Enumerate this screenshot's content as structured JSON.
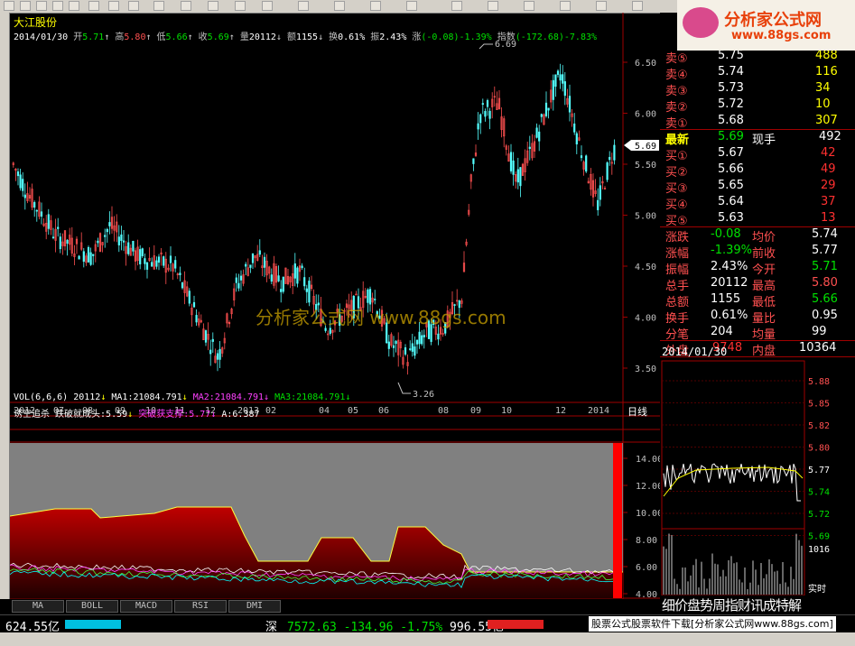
{
  "stock": {
    "name": "大江股份",
    "date": "2014/01/30",
    "open_label": "开",
    "open": "5.71",
    "high_label": "高",
    "high": "5.80",
    "low_label": "低",
    "low": "5.66",
    "close_label": "收",
    "close": "5.69",
    "volume_label": "量",
    "volume": "20112",
    "amount_label": "额",
    "amount": "1155",
    "turnover_label": "换",
    "turnover": "0.61%",
    "amplitude_label": "振",
    "amplitude": "2.43%",
    "change_label": "涨",
    "change": "(-0.08)-1.39%",
    "index_label": "指数",
    "index": "(-172.68)-7.83%"
  },
  "price_axis": [
    "6.50",
    "6.00",
    "5.50",
    "5.00",
    "4.50",
    "4.00",
    "3.50"
  ],
  "current_price_tag": "5.69",
  "peak_label": "6.69",
  "trough_label": "3.26",
  "watermark": "分析家公式网 www.88gs.com",
  "date_axis": [
    "2012",
    "07",
    "08",
    "09",
    "10",
    "11",
    "12",
    "2013",
    "02",
    "04",
    "05",
    "06",
    "08",
    "09",
    "10",
    "12",
    "2014"
  ],
  "period_label": "日线",
  "volume_line": {
    "vol": "VOL(6,6,6) 20112",
    "ma1": "MA1:21084.791",
    "ma2": "MA2:21084.791",
    "ma3": "MA3:21084.791"
  },
  "indicator_line": {
    "name": "诱空追杀",
    "breakdown": "跌破就成头:5.59",
    "breakout": "突破获支撑:5.77",
    "a": "A:6.387"
  },
  "indicator_axis": [
    "14.00",
    "12.00",
    "10.00",
    "8.00",
    "6.00",
    "4.00"
  ],
  "tabs": [
    "MA",
    "BOLL",
    "MACD",
    "RSI",
    "DMI"
  ],
  "quote": {
    "sells": [
      {
        "label": "卖⑤",
        "price": "5.75",
        "vol": "488"
      },
      {
        "label": "卖④",
        "price": "5.74",
        "vol": "116"
      },
      {
        "label": "卖③",
        "price": "5.73",
        "vol": "34"
      },
      {
        "label": "卖②",
        "price": "5.72",
        "vol": "10"
      },
      {
        "label": "卖①",
        "price": "5.68",
        "vol": "307"
      }
    ],
    "latest": {
      "label": "最新",
      "price": "5.69",
      "hand_label": "现手",
      "hand": "492"
    },
    "buys": [
      {
        "label": "买①",
        "price": "5.67",
        "vol": "42"
      },
      {
        "label": "买②",
        "price": "5.66",
        "vol": "49"
      },
      {
        "label": "买③",
        "price": "5.65",
        "vol": "29"
      },
      {
        "label": "买④",
        "price": "5.64",
        "vol": "37"
      },
      {
        "label": "买⑤",
        "price": "5.63",
        "vol": "13"
      }
    ],
    "stats": [
      {
        "l1": "涨跌",
        "v1": "-0.08",
        "l2": "均价",
        "v2": "5.74",
        "c1": "green",
        "c2": "white"
      },
      {
        "l1": "涨幅",
        "v1": "-1.39%",
        "l2": "前收",
        "v2": "5.77",
        "c1": "green",
        "c2": "white"
      },
      {
        "l1": "振幅",
        "v1": "2.43%",
        "l2": "今开",
        "v2": "5.71",
        "c1": "white",
        "c2": "green"
      },
      {
        "l1": "总手",
        "v1": "20112",
        "l2": "最高",
        "v2": "5.80",
        "c1": "white",
        "c2": "red"
      },
      {
        "l1": "总额",
        "v1": "1155",
        "l2": "最低",
        "v2": "5.66",
        "c1": "white",
        "c2": "green"
      },
      {
        "l1": "换手",
        "v1": "0.61%",
        "l2": "量比",
        "v2": "0.95",
        "c1": "white",
        "c2": "white"
      },
      {
        "l1": "分笔",
        "v1": "204",
        "l2": "均量",
        "v2": "99",
        "c1": "white",
        "c2": "white"
      }
    ],
    "outer_label": "外盘",
    "outer": "9748",
    "inner_label": "内盘",
    "inner": "10364"
  },
  "intraday": {
    "date": "2014/01/30",
    "axis": [
      "5.88",
      "5.85",
      "5.82",
      "5.80",
      "5.77",
      "5.74",
      "5.72",
      "5.69"
    ],
    "vol_max": "1016",
    "realtime_label": "实时"
  },
  "right_tabs": "细价盘势周指财讯成特解",
  "logo": {
    "text": "分析家公式网",
    "url": "www.88gs.com"
  },
  "status": {
    "left_value": "624.55亿",
    "market": "深",
    "index": "7572.63",
    "change": "-134.96",
    "pct": "-1.75%",
    "amount": "996.55亿",
    "ad": "股票公式股票软件下载[分析家公式网www.88gs.com]"
  }
}
